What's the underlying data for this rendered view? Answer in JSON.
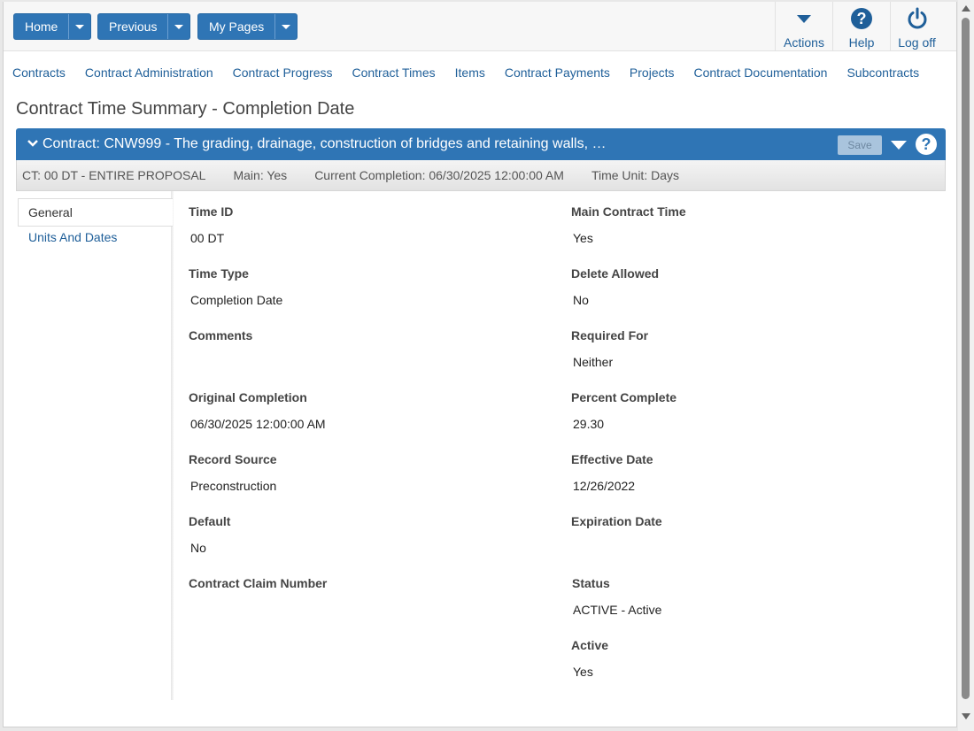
{
  "toolbar": {
    "home": "Home",
    "previous": "Previous",
    "my_pages": "My Pages",
    "actions": "Actions",
    "help": "Help",
    "logoff": "Log off"
  },
  "nav": {
    "items": [
      "Contracts",
      "Contract Administration",
      "Contract Progress",
      "Contract Times",
      "Items",
      "Contract Payments",
      "Projects",
      "Contract Documentation",
      "Subcontracts"
    ]
  },
  "page": {
    "title": "Contract Time Summary - Completion Date"
  },
  "contract": {
    "title": "Contract: CNW999 - The grading, drainage, construction of bridges and retaining walls, …",
    "save": "Save"
  },
  "summary": {
    "ct": "CT: 00 DT - ENTIRE PROPOSAL",
    "main": "Main: Yes",
    "current_completion": "Current Completion: 06/30/2025 12:00:00 AM",
    "time_unit": "Time Unit: Days"
  },
  "tabs": {
    "general": "General",
    "units_dates": "Units And Dates"
  },
  "fields": {
    "time_id_label": "Time ID",
    "time_id_value": "00 DT",
    "time_type_label": "Time Type",
    "time_type_value": "Completion Date",
    "comments_label": "Comments",
    "original_completion_label": "Original Completion",
    "original_completion_value": "06/30/2025 12:00:00 AM",
    "record_source_label": "Record Source",
    "record_source_value": "Preconstruction",
    "default_label": "Default",
    "default_value": "No",
    "contract_claim_label": "Contract Claim Number",
    "main_contract_time_label": "Main Contract Time",
    "main_contract_time_value": "Yes",
    "delete_allowed_label": "Delete Allowed",
    "delete_allowed_value": "No",
    "required_for_label": "Required For",
    "required_for_value": "Neither",
    "percent_complete_label": "Percent Complete",
    "percent_complete_value": "29.30",
    "effective_date_label": "Effective Date",
    "effective_date_value": "12/26/2022",
    "expiration_date_label": "Expiration Date",
    "status_label": "Status",
    "status_value": "ACTIVE - Active",
    "active_label": "Active",
    "active_value": "Yes"
  },
  "colors": {
    "primary_blue": "#2f75b5",
    "link_blue": "#1f5f99"
  }
}
